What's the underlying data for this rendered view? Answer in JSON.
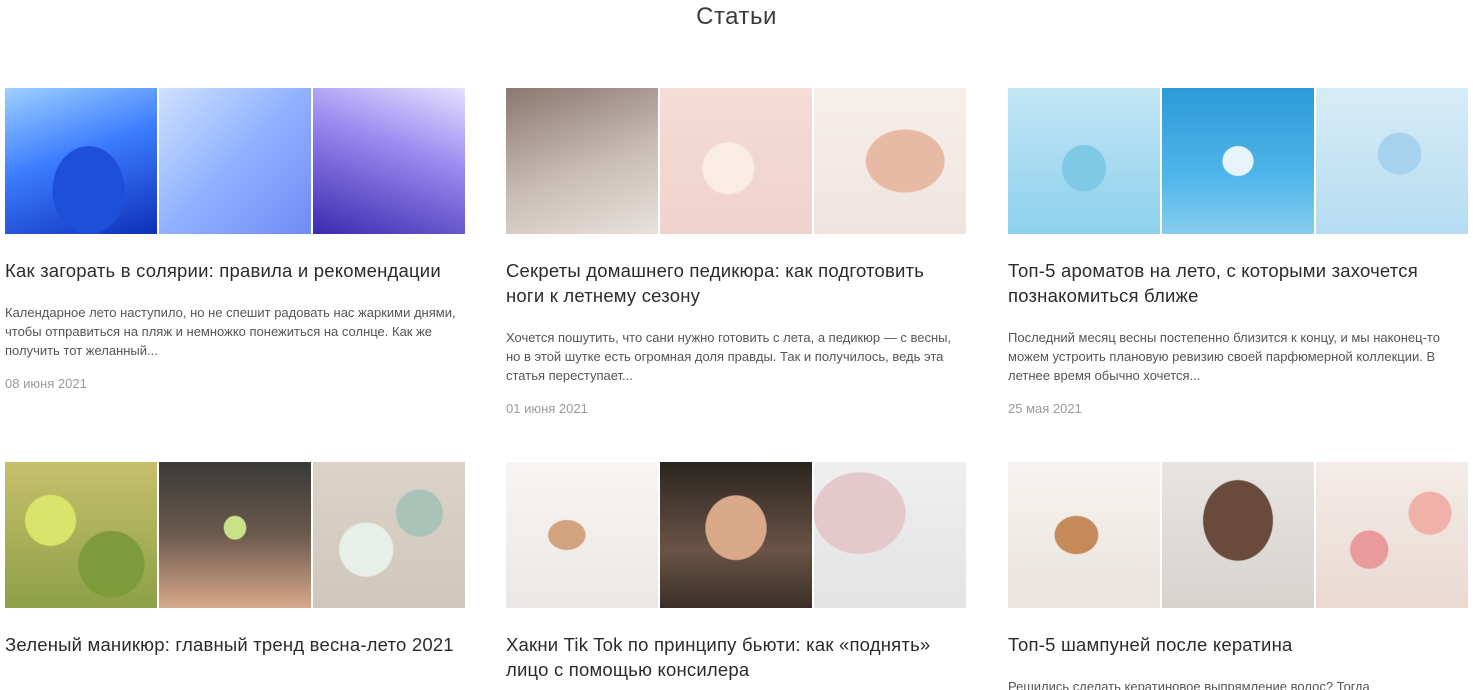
{
  "page": {
    "title": "Статьи"
  },
  "articles": [
    {
      "images": [
        "solarium-1",
        "solarium-2",
        "solarium-3"
      ],
      "title": "Как загорать в солярии: правила и рекомендации",
      "excerpt": "Календарное лето наступило, но не спешит радовать нас жаркими днями, чтобы отправиться на пляж и немножко понежиться на солнце. Как же получить тот желанный...",
      "date": "08 июня 2021"
    },
    {
      "images": [
        "pedi-1",
        "pedi-2",
        "pedi-3"
      ],
      "title": "Секреты домашнего педикюра: как подготовить ноги к летнему сезону",
      "excerpt": "Хочется пошутить, что сани нужно готовить с лета, а педикюр — с весны, но в этой шутке есть огромная доля правды. Так и получилось, ведь эта статья переступает...",
      "date": "01 июня 2021"
    },
    {
      "images": [
        "perf-1",
        "perf-2",
        "perf-3"
      ],
      "title": "Топ-5 ароматов на лето, с которыми захочется познакомиться ближе",
      "excerpt": "Последний месяц весны постепенно близится к концу, и мы наконец-то можем устроить плановую ревизию своей парфюмерной коллекции. В летнее время обычно хочется...",
      "date": "25 мая 2021"
    },
    {
      "images": [
        "green-1",
        "green-2",
        "green-3"
      ],
      "title": "Зеленый маникюр: главный тренд весна-лето 2021",
      "excerpt": "",
      "date": ""
    },
    {
      "images": [
        "tiktok-1",
        "tiktok-2",
        "tiktok-3"
      ],
      "title": "Хакни Tik Tok по принципу бьюти: как «поднять» лицо с помощью консилера",
      "excerpt": "",
      "date": ""
    },
    {
      "images": [
        "shampoo-1",
        "shampoo-2",
        "shampoo-3"
      ],
      "title": "Топ-5 шампуней после кератина",
      "excerpt": "Решились сделать кератиновое выпрямление волос? Тогда",
      "date": ""
    }
  ]
}
